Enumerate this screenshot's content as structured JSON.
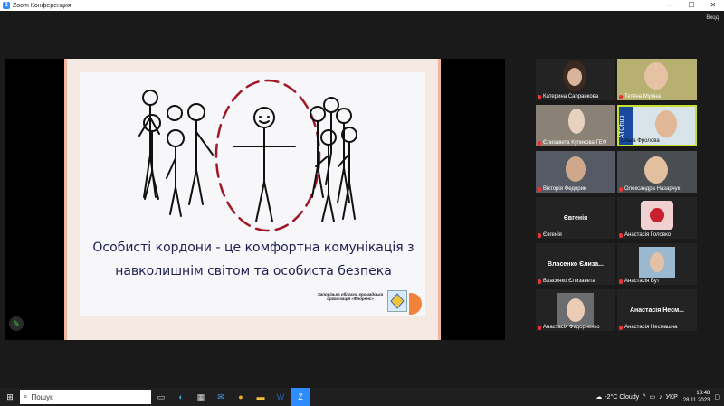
{
  "window": {
    "title": "Zoom Конференция",
    "minimize": "—",
    "maximize": "☐",
    "close": "✕",
    "exit": "Вход"
  },
  "slide": {
    "line1": "Особисті кордони - це комфортна комунікація з",
    "line2": "навколишнім світом та особиста безпека",
    "org": "Запорізька обласна громадська організація «Флоренс»"
  },
  "participants": [
    {
      "name": "Катерина Сапранкова",
      "muted": true
    },
    {
      "name": "Тетяна Мухіна",
      "muted": true
    },
    {
      "name": "Єлизавета Куликова ГЕФ",
      "muted": true
    },
    {
      "name": "Ольга Фролова",
      "muted": false
    },
    {
      "name": "Вікторія Федорик",
      "muted": true
    },
    {
      "name": "Олександра Назарчук",
      "muted": true
    },
    {
      "name": "Євгенія",
      "label": "Євгенія",
      "muted": true
    },
    {
      "name": "Анастасія Головко",
      "muted": true
    },
    {
      "name": "Власенко Єлизавета",
      "label": "Власенко Єлиза...",
      "muted": true
    },
    {
      "name": "Анастасія Бут",
      "muted": true
    },
    {
      "name": "Анастасія Федорченко",
      "muted": true
    },
    {
      "name": "Анастасія Несмашна",
      "label": "Анастасія Несм...",
      "muted": true
    }
  ],
  "taskbar": {
    "search": "Пошук",
    "weather": "-2°C  Cloudy",
    "lang": "УКР",
    "time": "13:48",
    "date": "28.11.2023"
  }
}
